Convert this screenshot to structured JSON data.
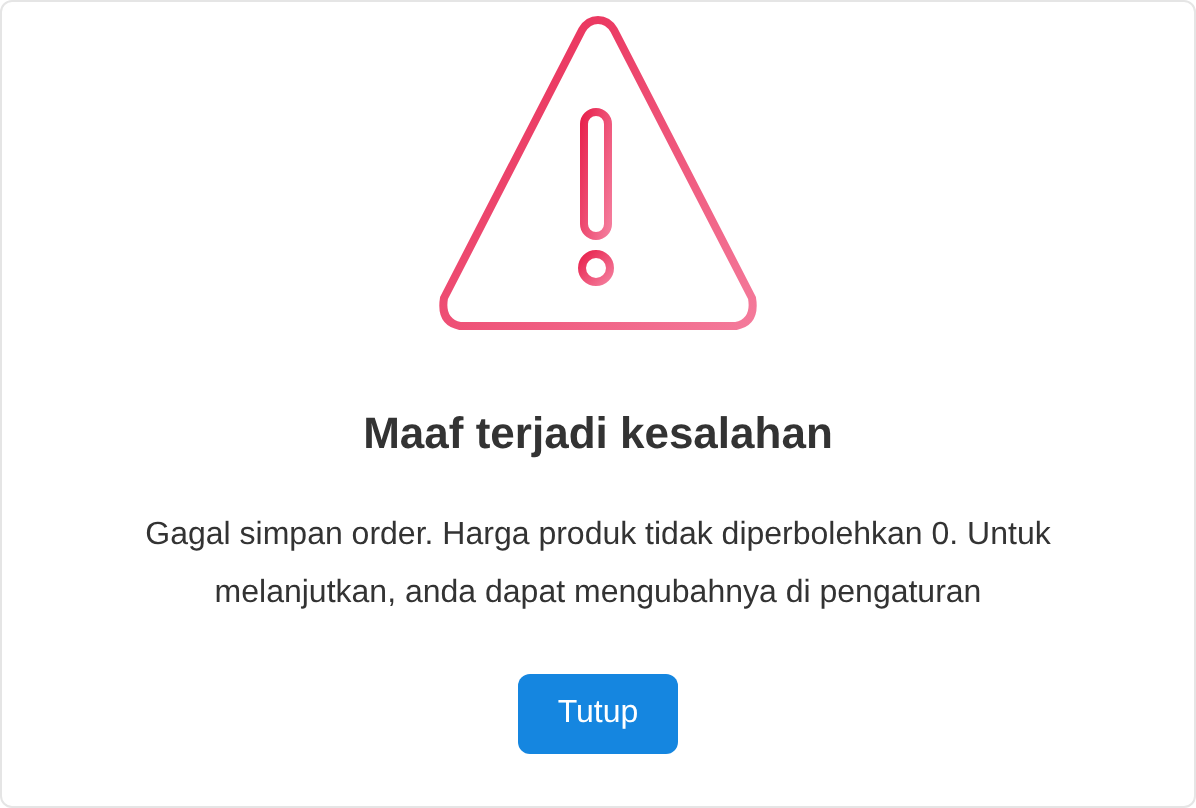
{
  "dialog": {
    "title": "Maaf terjadi kesalahan",
    "message": "Gagal simpan order. Harga produk tidak diperbolehkan 0. Untuk melanjutkan, anda dapat mengubahnya di pengaturan",
    "buttons": [
      {
        "label": "Tutup",
        "kind": "primary"
      }
    ]
  }
}
